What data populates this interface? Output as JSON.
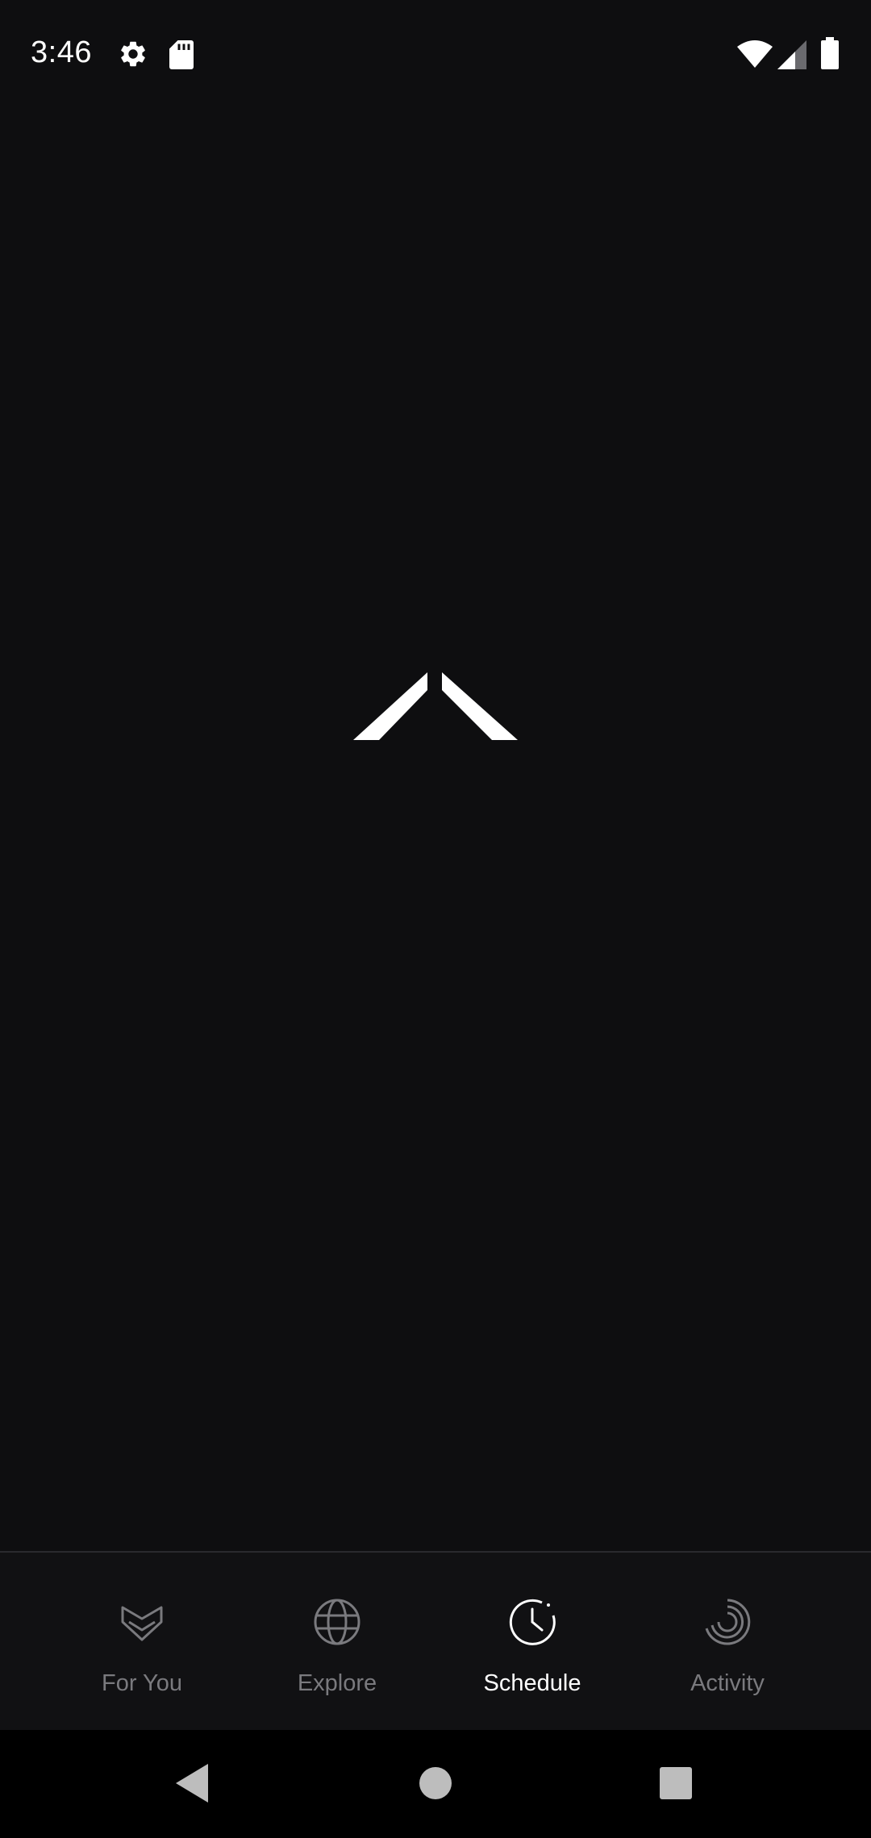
{
  "status_bar": {
    "time": "3:46",
    "icons": [
      "settings-icon",
      "sd-card-icon",
      "wifi-icon",
      "cellular-signal-icon",
      "battery-icon"
    ]
  },
  "splash": {
    "logo_icon": "app-logo-chevron-icon"
  },
  "bottom_nav": {
    "active_index": 2,
    "items": [
      {
        "label": "For You",
        "icon": "heart-chevron-icon"
      },
      {
        "label": "Explore",
        "icon": "globe-icon"
      },
      {
        "label": "Schedule",
        "icon": "clock-icon"
      },
      {
        "label": "Activity",
        "icon": "activity-rings-icon"
      }
    ]
  },
  "system_nav": {
    "buttons": [
      "back-icon",
      "home-icon",
      "recents-icon"
    ]
  },
  "colors": {
    "background": "#0e0e10",
    "nav_background": "#111113",
    "active": "#ffffff",
    "inactive": "#7a7a7e"
  }
}
